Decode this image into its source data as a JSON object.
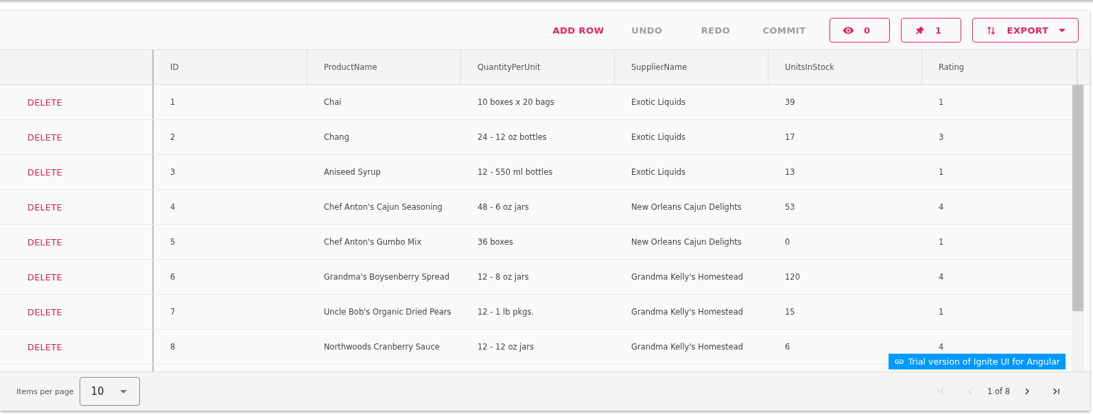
{
  "toolbar": {
    "actions": [
      {
        "label": "ADD ROW",
        "disabled": false
      },
      {
        "label": "UNDO",
        "disabled": true
      },
      {
        "label": "REDO",
        "disabled": true
      },
      {
        "label": "COMMIT",
        "disabled": true
      }
    ],
    "hidden_count": {
      "label": "0"
    },
    "pinned_count": {
      "label": "1"
    },
    "export": {
      "label": "EXPORT"
    }
  },
  "table": {
    "columns": [
      "ID",
      "ProductName",
      "QuantityPerUnit",
      "SupplierName",
      "UnitsInStock",
      "Rating"
    ],
    "rows": [
      {
        "action": "DELETE",
        "cells": [
          "1",
          "Chai",
          "10 boxes x 20 bags",
          "Exotic Liquids",
          "39",
          "1"
        ]
      },
      {
        "action": "DELETE",
        "cells": [
          "2",
          "Chang",
          "24 - 12 oz bottles",
          "Exotic Liquids",
          "17",
          "3"
        ]
      },
      {
        "action": "DELETE",
        "cells": [
          "3",
          "Aniseed Syrup",
          "12 - 550 ml bottles",
          "Exotic Liquids",
          "13",
          "1"
        ]
      },
      {
        "action": "DELETE",
        "cells": [
          "4",
          "Chef Anton's Cajun Seasoning",
          "48 - 6 oz jars",
          "New Orleans Cajun Delights",
          "53",
          "4"
        ]
      },
      {
        "action": "DELETE",
        "cells": [
          "5",
          "Chef Anton's Gumbo Mix",
          "36 boxes",
          "New Orleans Cajun Delights",
          "0",
          "1"
        ]
      },
      {
        "action": "DELETE",
        "cells": [
          "6",
          "Grandma's Boysenberry Spread",
          "12 - 8 oz jars",
          "Grandma Kelly's Homestead",
          "120",
          "4"
        ]
      },
      {
        "action": "DELETE",
        "cells": [
          "7",
          "Uncle Bob's Organic Dried Pears",
          "12 - 1 lb pkgs.",
          "Grandma Kelly's Homestead",
          "15",
          "1"
        ]
      },
      {
        "action": "DELETE",
        "cells": [
          "8",
          "Northwoods Cranberry Sauce",
          "12 - 12 oz jars",
          "Grandma Kelly's Homestead",
          "6",
          "4"
        ]
      }
    ]
  },
  "trial_badge": {
    "label": "Trial version of Ignite UI for Angular"
  },
  "paginator": {
    "items_per_page_label": "Items per page",
    "items_per_page": "10",
    "page_info": "1 of 8",
    "buttons": [
      {
        "kind": "first",
        "disabled": true
      },
      {
        "kind": "prev",
        "disabled": true
      },
      {
        "kind": "next",
        "disabled": false
      },
      {
        "kind": "last",
        "disabled": false
      }
    ]
  }
}
